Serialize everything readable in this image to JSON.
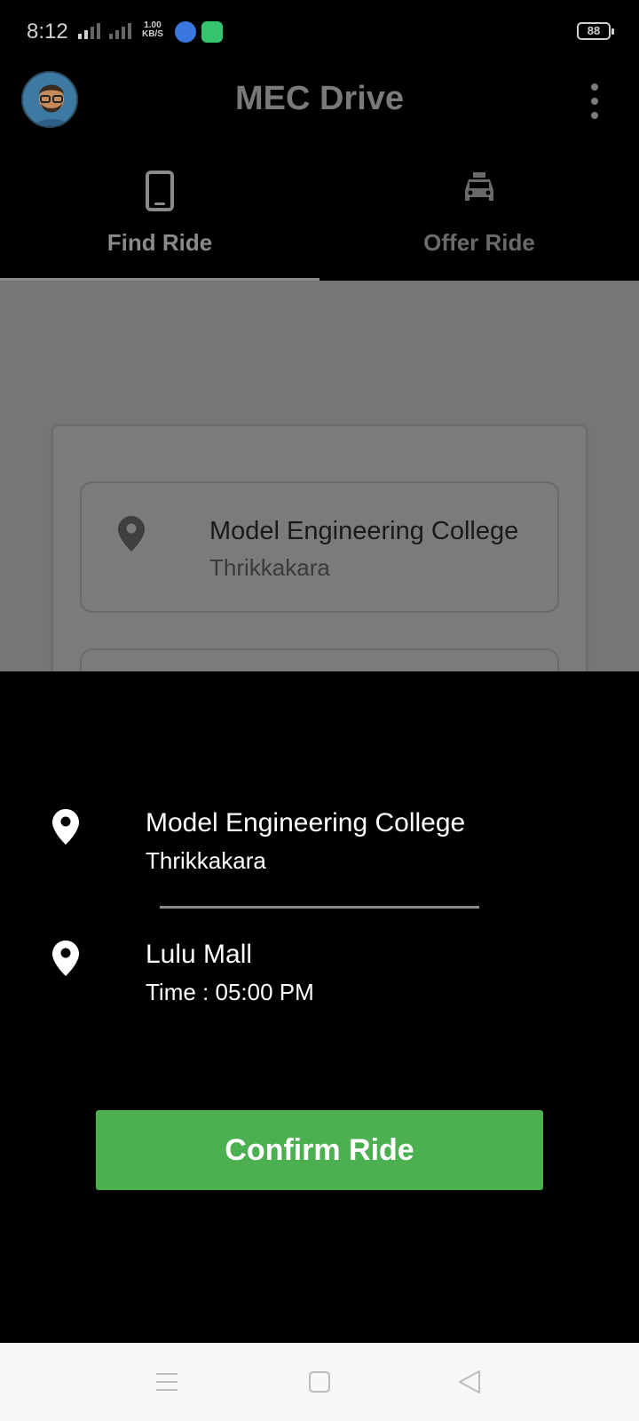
{
  "status_bar": {
    "time": "8:12",
    "net_speed_value": "1.00",
    "net_speed_unit": "KB/S",
    "battery": "88"
  },
  "app_bar": {
    "title": "MEC Drive"
  },
  "tabs": [
    {
      "label": "Find Ride",
      "icon": "phone-icon",
      "active": true
    },
    {
      "label": "Offer Ride",
      "icon": "car-icon",
      "active": false
    }
  ],
  "form": {
    "from": {
      "place": "Model Engineering College",
      "area": "Thrikkakara"
    }
  },
  "sheet": {
    "from": {
      "place": "Model Engineering College",
      "area": "Thrikkakara"
    },
    "to": {
      "place": "Lulu Mall",
      "time": "Time : 05:00 PM"
    },
    "confirm_label": "Confirm Ride"
  },
  "colors": {
    "accent": "#4caf50",
    "background": "#000000",
    "scrim": "#767676"
  }
}
